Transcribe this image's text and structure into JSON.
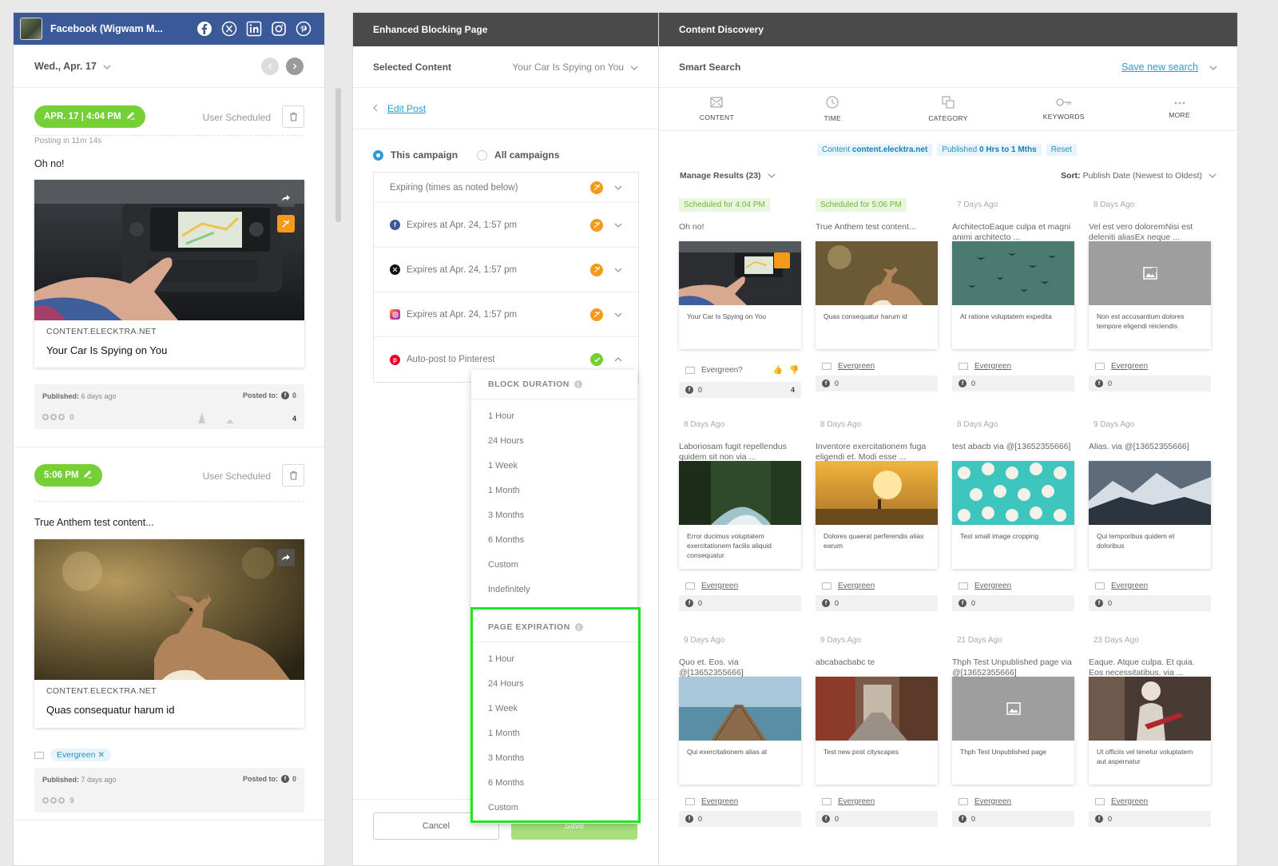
{
  "left": {
    "account_name": "Facebook (Wigwam M...",
    "date": "Wed., Apr. 17",
    "posts": [
      {
        "time": "APR. 17 | 4:04 PM",
        "status": "User Scheduled",
        "posting_in": "Posting in 11m 14s",
        "message": "Oh no!",
        "domain": "CONTENT.ELECKTRA.NET",
        "title": "Your Car Is Spying on You",
        "published_label": "Published:",
        "published": "6 days ago",
        "posted_to_label": "Posted to:",
        "posted_to": "0",
        "engagement": "0",
        "count": "4"
      },
      {
        "time": "5:06 PM",
        "status": "User Scheduled",
        "message": "True Anthem test content...",
        "domain": "CONTENT.ELECKTRA.NET",
        "title": "Quas consequatur harum id",
        "tag": "Evergreen",
        "published_label": "Published:",
        "published": "7 days ago",
        "posted_to_label": "Posted to:",
        "posted_to": "0",
        "engagement": "9"
      }
    ]
  },
  "middle": {
    "header": "Enhanced Blocking Page",
    "selected_content_label": "Selected Content",
    "selected_content_value": "Your Car Is Spying on You",
    "edit_post": "Edit Post",
    "radio_this": "This campaign",
    "radio_all": "All campaigns",
    "expiring_label": "Expiring (times as noted below)",
    "expirations": [
      {
        "network": "facebook",
        "text": "Expires at Apr. 24, 1:57 pm"
      },
      {
        "network": "x",
        "text": "Expires at Apr. 24, 1:57 pm"
      },
      {
        "network": "instagram",
        "text": "Expires at Apr. 24, 1:57 pm"
      }
    ],
    "pinterest_label": "Auto-post to Pinterest",
    "dropdown": {
      "block_duration_title": "BLOCK DURATION",
      "block_duration_options": [
        "1 Hour",
        "24 Hours",
        "1 Week",
        "1 Month",
        "3 Months",
        "6 Months",
        "Custom",
        "Indefinitely"
      ],
      "page_expiration_title": "PAGE EXPIRATION",
      "page_expiration_options": [
        "1 Hour",
        "24 Hours",
        "1 Week",
        "1 Month",
        "3 Months",
        "6 Months",
        "Custom"
      ]
    },
    "cancel": "Cancel",
    "save": "Save"
  },
  "right": {
    "header": "Content Discovery",
    "smart_search": "Smart Search",
    "save_new_search": "Save new search",
    "filters": [
      "CONTENT",
      "TIME",
      "CATEGORY",
      "KEYWORDS",
      "MORE"
    ],
    "crumb_content_label": "Content",
    "crumb_content_value": "content.elecktra.net",
    "crumb_published_label": "Published",
    "crumb_published_value": "0 Hrs to 1 Mths",
    "crumb_reset": "Reset",
    "manage_results": "Manage Results (23)",
    "sort_label": "Sort:",
    "sort_value": "Publish Date (Newest to Oldest)",
    "evergreen_q": "Evergreen?",
    "tiles": [
      {
        "label": "Scheduled for 4:04 PM",
        "text": "Oh no!",
        "caption": "Your Car Is Spying on You",
        "evg": "Evergreen?",
        "stat": "0",
        "count": "4"
      },
      {
        "label": "Scheduled for 5:06 PM",
        "text": "True Anthem test content...",
        "caption": "Quas consequatur harum id",
        "evg": "Evergreen",
        "stat": "0"
      },
      {
        "label": "7 Days Ago",
        "text": "ArchitectoEaque culpa et magni animi architecto ...",
        "caption": "At ratione voluptatem expedita",
        "evg": "Evergreen",
        "stat": "0"
      },
      {
        "label": "8 Days Ago",
        "text": "Vel est vero doloremNisi est deleniti aliasEx neque ...",
        "caption": "Non est accusantium dolores tempore eligendi reiciendis",
        "evg": "Evergreen",
        "stat": "0"
      },
      {
        "label": "8 Days Ago",
        "text": "Laboriosam fugit repellendus quidem sit non via ...",
        "caption": "Error ducimus voluptatem exercitationem facilis aliquid consequatur",
        "evg": "Evergreen",
        "stat": "0"
      },
      {
        "label": "8 Days Ago",
        "text": "Inventore exercitationem fuga eligendi et. Modi esse ...",
        "caption": "Dolores quaerat perferendis alias earum",
        "evg": "Evergreen",
        "stat": "0"
      },
      {
        "label": "8 Days Ago",
        "text": "test abacb via @[13652355666]",
        "caption": "Test small image cropping",
        "evg": "Evergreen",
        "stat": "0"
      },
      {
        "label": "9 Days Ago",
        "text": "Alias. via @[13652355666]",
        "caption": "Qui temporibus quidem et doloribus",
        "evg": "Evergreen",
        "stat": "0"
      },
      {
        "label": "9 Days Ago",
        "text": "Quo et. Eos. via @[13652355666]",
        "caption": "Qui exercitationem alias at",
        "evg": "Evergreen",
        "stat": "0"
      },
      {
        "label": "9 Days Ago",
        "text": "abcabacbabc te",
        "caption": "Test new post cityscapes",
        "evg": "Evergreen",
        "stat": "0"
      },
      {
        "label": "21 Days Ago",
        "text": "Thph Test Unpublished page via @[13652355666]",
        "caption": "Thph Test Unpublished page",
        "evg": "Evergreen",
        "stat": "0"
      },
      {
        "label": "23 Days Ago",
        "text": "Eaque. Atque culpa. Et quia. Eos necessitatibus. via ...",
        "caption": "Ut officiis vel tenetur voluptatem aut aspernatur",
        "evg": "Evergreen",
        "stat": "0"
      }
    ]
  }
}
